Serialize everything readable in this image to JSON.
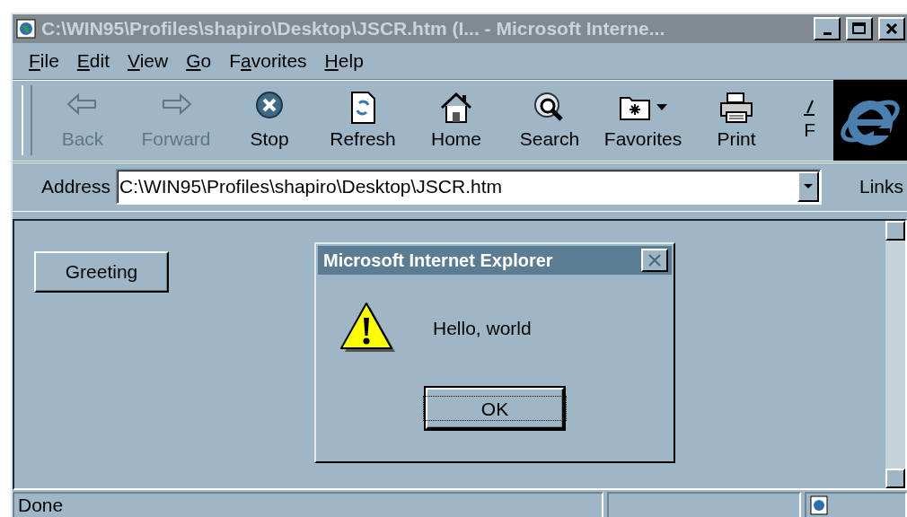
{
  "window": {
    "title": "C:\\WIN95\\Profiles\\shapiro\\Desktop\\JSCR.htm (I... - Microsoft Interne...",
    "active": false
  },
  "menu": [
    {
      "key": "F",
      "post": "ile"
    },
    {
      "key": "E",
      "post": "dit"
    },
    {
      "key": "V",
      "post": "iew"
    },
    {
      "key": "G",
      "post": "o"
    },
    {
      "pre": "F",
      "key": "a",
      "post": "vorites"
    },
    {
      "key": "H",
      "post": "elp"
    }
  ],
  "toolbar": [
    {
      "label": "Back",
      "disabled": true,
      "dropdown": false
    },
    {
      "label": "Forward",
      "disabled": true,
      "dropdown": false
    },
    {
      "label": "Stop",
      "disabled": false,
      "dropdown": false
    },
    {
      "label": "Refresh",
      "disabled": false,
      "dropdown": false
    },
    {
      "label": "Home",
      "disabled": false,
      "dropdown": false
    },
    {
      "label": "Search",
      "disabled": false,
      "dropdown": false
    },
    {
      "label": "Favorites",
      "disabled": false,
      "dropdown": true
    },
    {
      "label": "Print",
      "disabled": false,
      "dropdown": false
    },
    {
      "label": "F",
      "disabled": false,
      "dropdown": false
    }
  ],
  "address": {
    "label": "Address",
    "value": "C:\\WIN95\\Profiles\\shapiro\\Desktop\\JSCR.htm"
  },
  "links": {
    "label": "Links"
  },
  "page": {
    "button": "Greeting"
  },
  "dialog": {
    "title": "Microsoft Internet Explorer",
    "message": "Hello, world",
    "button": "OK",
    "focused": true
  },
  "status_bar": {
    "text": "Done"
  }
}
